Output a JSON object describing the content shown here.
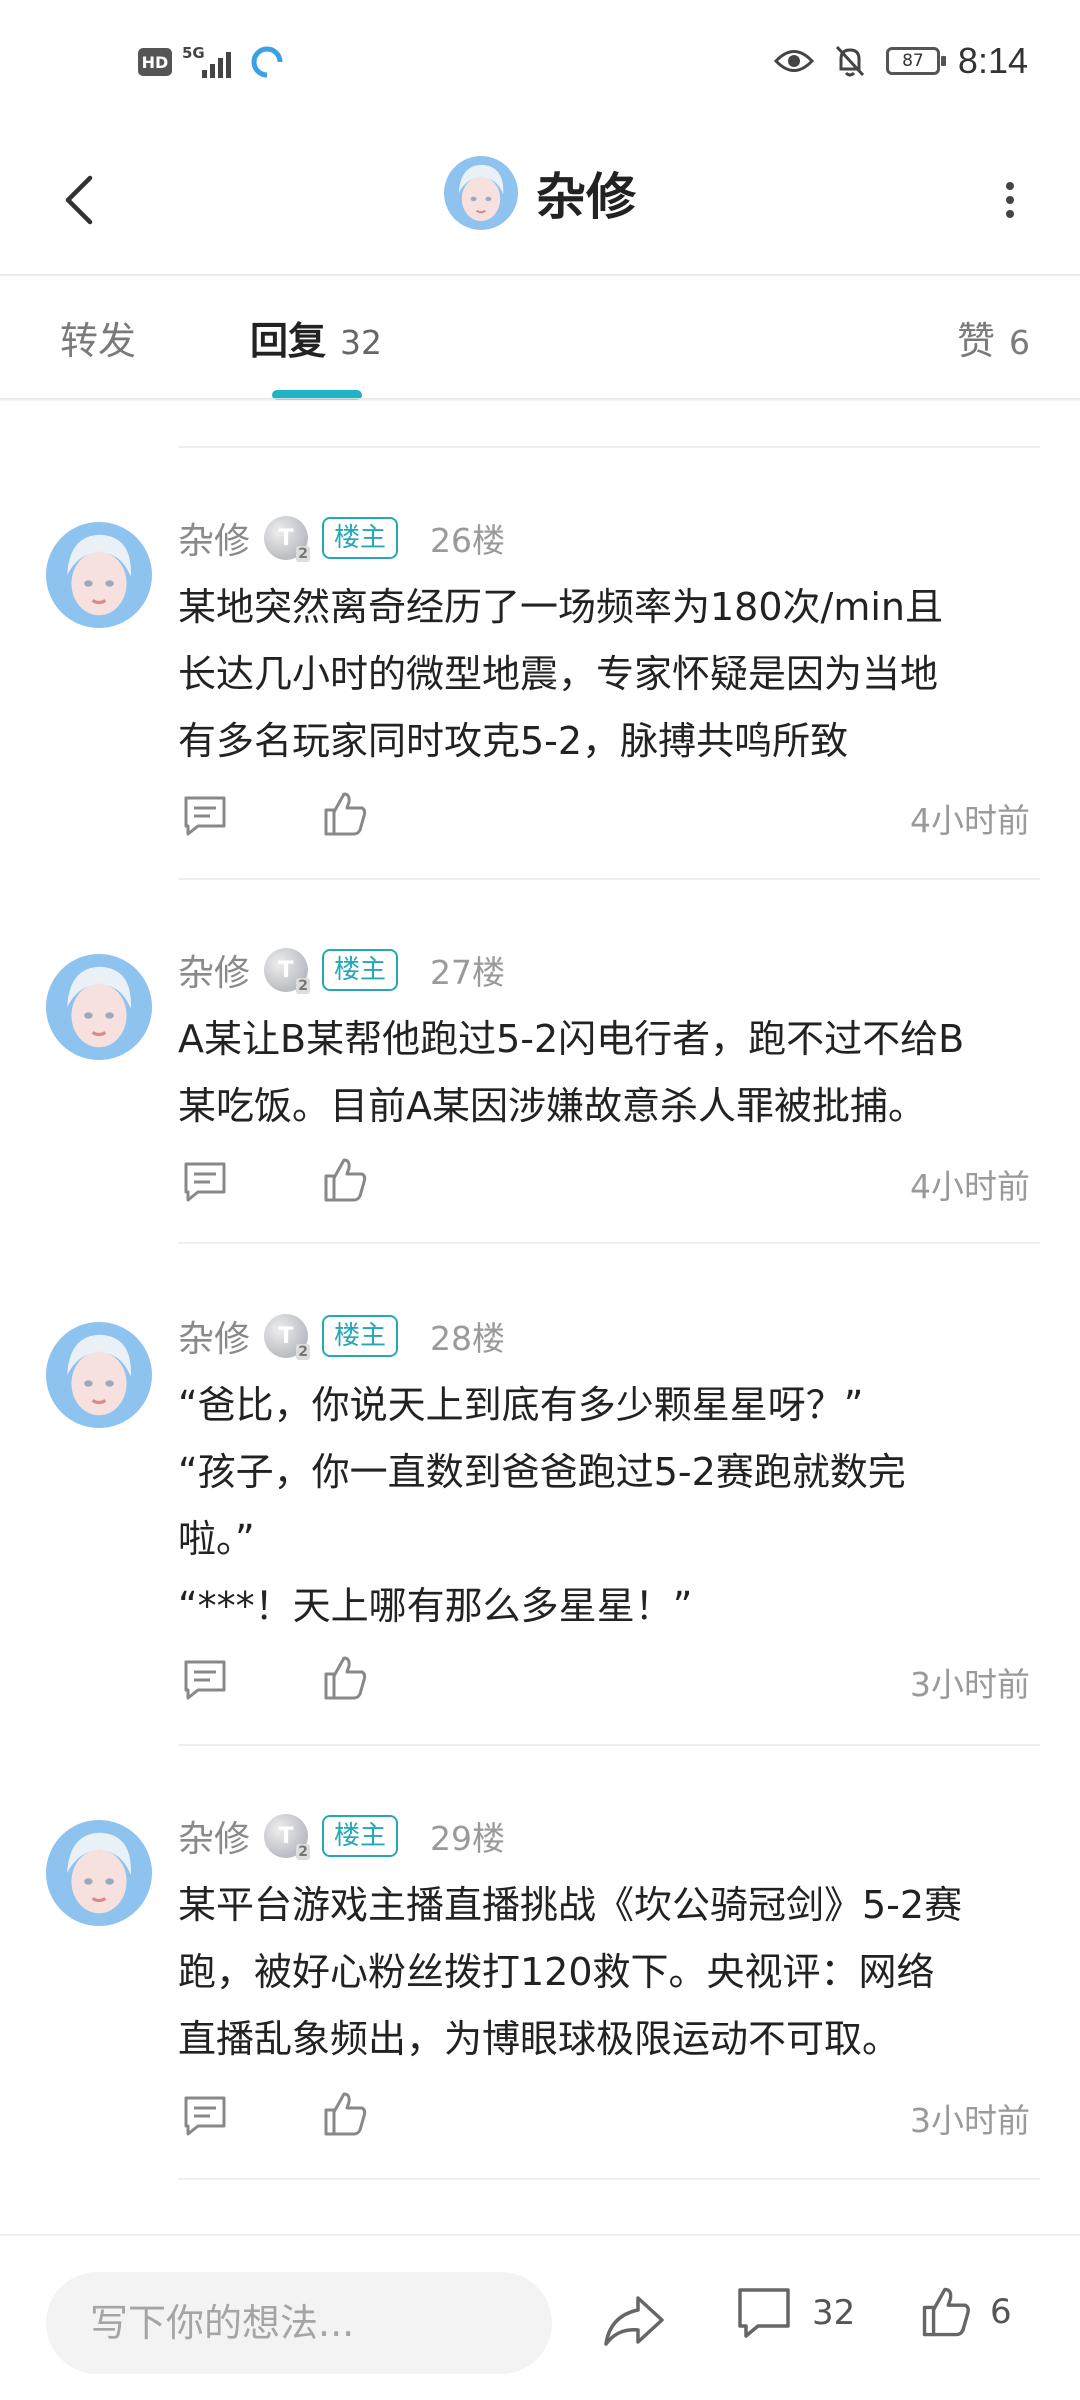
{
  "status_bar": {
    "hd": "HD",
    "network": "5G",
    "battery": "87",
    "time": "8:14"
  },
  "header": {
    "title": "杂修"
  },
  "tabs": {
    "forward": {
      "label": "转发"
    },
    "reply": {
      "label": "回复",
      "count": "32"
    },
    "like": {
      "label": "赞",
      "count": "6"
    }
  },
  "posts": [
    {
      "author": "杂修",
      "level": "T",
      "level_num": "2",
      "badge": "楼主",
      "floor": "26楼",
      "lines": [
        "某地突然离奇经历了一场频率为180次/min且",
        "长达几小时的微型地震，专家怀疑是因为当地",
        "有多名玩家同时攻克5-2，脉搏共鸣所致"
      ],
      "time": "4小时前"
    },
    {
      "author": "杂修",
      "level": "T",
      "level_num": "2",
      "badge": "楼主",
      "floor": "27楼",
      "lines": [
        "A某让B某帮他跑过5-2闪电行者，跑不过不给B",
        "某吃饭。目前A某因涉嫌故意杀人罪被批捕。"
      ],
      "time": "4小时前"
    },
    {
      "author": "杂修",
      "level": "T",
      "level_num": "2",
      "badge": "楼主",
      "floor": "28楼",
      "lines": [
        "“爸比，你说天上到底有多少颗星星呀？”",
        "“孩子，你一直数到爸爸跑过5-2赛跑就数完",
        "啦。”",
        "“***！天上哪有那么多星星！”"
      ],
      "time": "3小时前"
    },
    {
      "author": "杂修",
      "level": "T",
      "level_num": "2",
      "badge": "楼主",
      "floor": "29楼",
      "lines": [
        "某平台游戏主播直播挑战《坎公骑冠剑》5-2赛",
        "跑，被好心粉丝拨打120救下。央视评：网络",
        "直播乱象频出，为博眼球极限运动不可取。"
      ],
      "time": "3小时前"
    }
  ],
  "bottom_bar": {
    "placeholder": "写下你的想法...",
    "comment_count": "32",
    "like_count": "6"
  },
  "colors": {
    "accent": "#1fb3c6",
    "badge": "#24a8b8",
    "muted_text": "#9a9a9a"
  }
}
